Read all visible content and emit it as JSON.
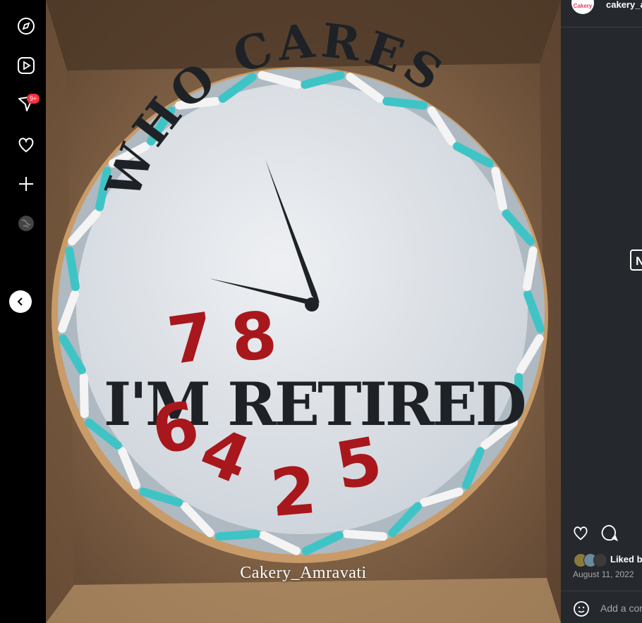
{
  "rail": {
    "icons": [
      "compass-icon",
      "reels-icon",
      "messages-icon",
      "heart-icon",
      "plus-icon",
      "profile-globe-icon"
    ],
    "notification_badge": "9+"
  },
  "post": {
    "watermark": "Cakery_Amravati",
    "cake_text": {
      "arc": "WHO CARES",
      "main": "I'M RETIRED",
      "digits": [
        "7",
        "8",
        "6",
        "4",
        "2",
        "5"
      ]
    }
  },
  "panel": {
    "username": "cakery_a",
    "avatar_text": "Cakery",
    "next_label": "N",
    "liked_by": "Liked b",
    "date": "August 11, 2022",
    "comment_placeholder": "Add a com"
  },
  "colors": {
    "panel_bg": "#25282d",
    "badge": "#ff3040",
    "frosting": "#dfe3e8",
    "lettering": "#1e2226",
    "digits": "#a8171c",
    "sprinkle_teal": "#3fc4c6",
    "box": "#8a6a4a"
  }
}
